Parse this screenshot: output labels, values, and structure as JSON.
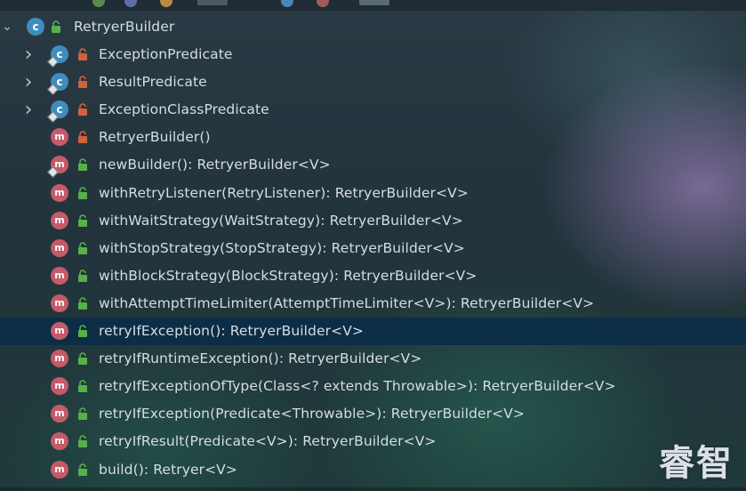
{
  "colors": {
    "selected_row": "#0a2c48",
    "class_badge": "#3f8dbf",
    "method_badge": "#c45a6a",
    "public_lock": "#58b04a",
    "private_lock": "#d0623f"
  },
  "tree": {
    "root": {
      "kind": "class",
      "kind_letter": "c",
      "visibility": "public",
      "label": "RetryerBuilder",
      "expanded": true
    },
    "items": [
      {
        "kind": "class",
        "kind_letter": "c",
        "visibility": "private",
        "label": "ExceptionPredicate",
        "expandable": true,
        "pinned": true
      },
      {
        "kind": "class",
        "kind_letter": "c",
        "visibility": "private",
        "label": "ResultPredicate",
        "expandable": true,
        "pinned": true
      },
      {
        "kind": "class",
        "kind_letter": "c",
        "visibility": "private",
        "label": "ExceptionClassPredicate",
        "expandable": true,
        "pinned": true
      },
      {
        "kind": "method",
        "kind_letter": "m",
        "visibility": "private",
        "label": "RetryerBuilder()"
      },
      {
        "kind": "method",
        "kind_letter": "m",
        "visibility": "public",
        "label": "newBuilder(): RetryerBuilder<V>",
        "pinned": true
      },
      {
        "kind": "method",
        "kind_letter": "m",
        "visibility": "public",
        "label": "withRetryListener(RetryListener): RetryerBuilder<V>"
      },
      {
        "kind": "method",
        "kind_letter": "m",
        "visibility": "public",
        "label": "withWaitStrategy(WaitStrategy): RetryerBuilder<V>"
      },
      {
        "kind": "method",
        "kind_letter": "m",
        "visibility": "public",
        "label": "withStopStrategy(StopStrategy): RetryerBuilder<V>"
      },
      {
        "kind": "method",
        "kind_letter": "m",
        "visibility": "public",
        "label": "withBlockStrategy(BlockStrategy): RetryerBuilder<V>"
      },
      {
        "kind": "method",
        "kind_letter": "m",
        "visibility": "public",
        "label": "withAttemptTimeLimiter(AttemptTimeLimiter<V>): RetryerBuilder<V>"
      },
      {
        "kind": "method",
        "kind_letter": "m",
        "visibility": "public",
        "label": "retryIfException(): RetryerBuilder<V>",
        "selected": true
      },
      {
        "kind": "method",
        "kind_letter": "m",
        "visibility": "public",
        "label": "retryIfRuntimeException(): RetryerBuilder<V>"
      },
      {
        "kind": "method",
        "kind_letter": "m",
        "visibility": "public",
        "label": "retryIfExceptionOfType(Class<? extends Throwable>): RetryerBuilder<V>"
      },
      {
        "kind": "method",
        "kind_letter": "m",
        "visibility": "public",
        "label": "retryIfException(Predicate<Throwable>): RetryerBuilder<V>"
      },
      {
        "kind": "method",
        "kind_letter": "m",
        "visibility": "public",
        "label": "retryIfResult(Predicate<V>): RetryerBuilder<V>"
      },
      {
        "kind": "method",
        "kind_letter": "m",
        "visibility": "public",
        "label": "build(): Retryer<V>"
      }
    ]
  },
  "watermark": "睿智",
  "icons": {
    "expanded": "chevron-down-icon",
    "collapsed": "chevron-right-icon",
    "class": "class-icon",
    "method": "method-icon",
    "public": "public-lock-icon",
    "private": "private-lock-icon"
  }
}
